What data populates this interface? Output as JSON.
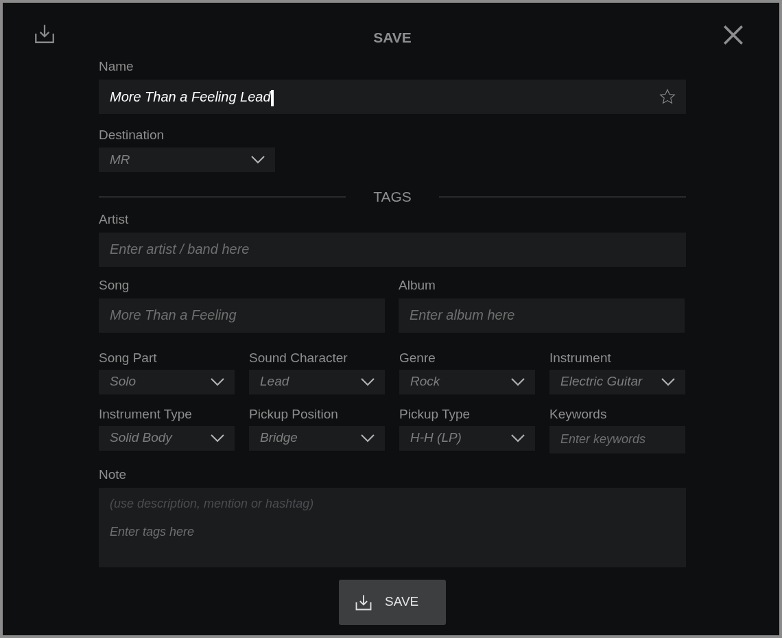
{
  "dialog": {
    "title": "SAVE"
  },
  "name": {
    "label": "Name",
    "value": "More Than a Feeling Lead",
    "focused": true,
    "favorite": false
  },
  "destination": {
    "label": "Destination",
    "value": "MR"
  },
  "tags_heading": "TAGS",
  "artist": {
    "label": "Artist",
    "placeholder": "Enter artist / band here"
  },
  "song": {
    "label": "Song",
    "placeholder": "More Than a Feeling"
  },
  "album": {
    "label": "Album",
    "placeholder": "Enter album here"
  },
  "tag_fields": [
    {
      "kind": "dropdown",
      "label": "Song Part",
      "value": "Solo"
    },
    {
      "kind": "dropdown",
      "label": "Sound Character",
      "value": "Lead"
    },
    {
      "kind": "dropdown",
      "label": "Genre",
      "value": "Rock"
    },
    {
      "kind": "dropdown",
      "label": "Instrument",
      "value": "Electric Guitar"
    },
    {
      "kind": "dropdown",
      "label": "Instrument Type",
      "value": "Solid Body"
    },
    {
      "kind": "dropdown",
      "label": "Pickup Position",
      "value": "Bridge"
    },
    {
      "kind": "dropdown",
      "label": "Pickup Type",
      "value": "H-H (LP)"
    },
    {
      "kind": "text",
      "label": "Keywords",
      "placeholder": "Enter keywords"
    }
  ],
  "note": {
    "label": "Note",
    "hint": "(use description, mention or hashtag)",
    "placeholder": "Enter tags here"
  },
  "save_button": {
    "label": "SAVE"
  }
}
